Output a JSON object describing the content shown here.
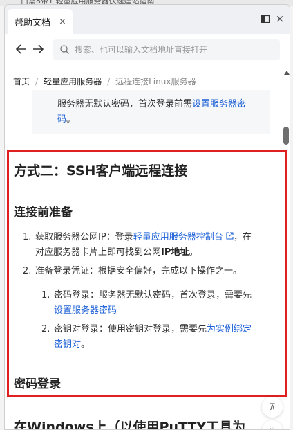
{
  "background": {
    "partial_text": "口需8带1 轻量应用服务器快速建站指南"
  },
  "tab": {
    "title": "帮助文档",
    "close_glyph": "×"
  },
  "window": {
    "sidebar_toggle_icon": "sidebar-panel-icon",
    "close_glyph": "×"
  },
  "nav": {
    "back_icon": "arrow-left-icon",
    "forward_icon": "arrow-right-icon",
    "search_placeholder": "搜索、也可以输入文档地址直接打开"
  },
  "breadcrumb": {
    "items": [
      "首页",
      "轻量应用服务器",
      "远程连接Linux服务器"
    ],
    "separator": "/"
  },
  "note": {
    "text": "服务器无默认密码，首次登录前需",
    "link_line1": "设置服务器密",
    "link_line2": "码",
    "suffix": "。"
  },
  "article": {
    "h2": "方式二：SSH客户端远程连接",
    "h3_prep": "连接前准备",
    "step1": {
      "num": "1.",
      "prefix": "获取服务器公网IP：登录",
      "link": "轻量应用服务器控制台",
      "after": "，在",
      "line2": "对应服务器卡片上即可找到公网",
      "line2_bold": "IP地址",
      "line2_end": "。"
    },
    "step2": {
      "num": "2.",
      "text": "准备登录凭证：根据安全偏好，完成以下操作之一。"
    },
    "sub1": {
      "num": "1.",
      "text": "密码登录：服务器无默认密码，首次登录，需要先",
      "link": "设置服务器密码"
    },
    "sub2": {
      "num": "2.",
      "text": "密钥对登录：使用密钥对登录，需要先",
      "link_part1": "为实例绑定",
      "link_part2": "密钥对",
      "suffix": "。"
    },
    "h3_pwd": "密码登录",
    "h2_windows": "在Windows上（以使用PuTTY工具为"
  },
  "floating": {
    "top_glyph": "⊼",
    "bottom_glyph": "✳"
  },
  "colors": {
    "link": "#1a5fd6",
    "highlight_border": "#e02020",
    "tab_bar": "#eef0f4"
  }
}
